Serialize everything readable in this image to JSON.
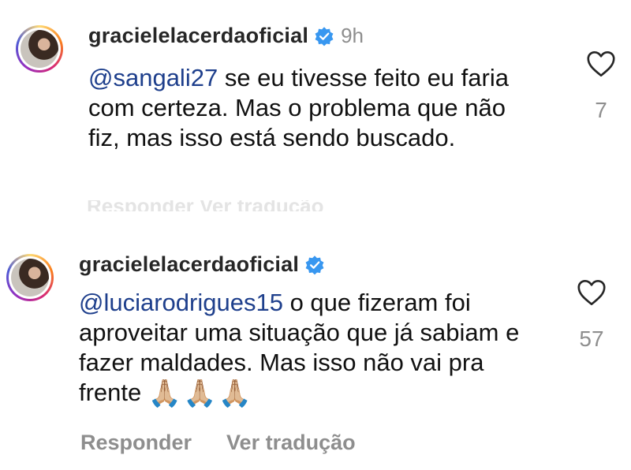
{
  "comments": [
    {
      "username": "gracielelacerdaoficial",
      "time": "9h",
      "mention": "@sangali27",
      "text": " se eu tivesse feito eu faria com certeza. Mas o problema que não fiz, mas isso está sendo buscado.",
      "likes": "7"
    },
    {
      "username": "gracielelacerdaoficial",
      "mention": "@luciarodrigues15",
      "text": " o que fizeram foi aproveitar uma situação que já sabiam e fazer maldades. Mas isso não vai pra frente ",
      "emoji": "🙏🏼🙏🏼🙏🏼",
      "likes": "57"
    }
  ],
  "faded_actions": "Responder   Ver tradução",
  "actions": {
    "reply": "Responder",
    "translate": "Ver tradução"
  },
  "colors": {
    "verified": "#3897f0",
    "mention": "#1e3f8c",
    "muted": "#8e8e8e"
  }
}
